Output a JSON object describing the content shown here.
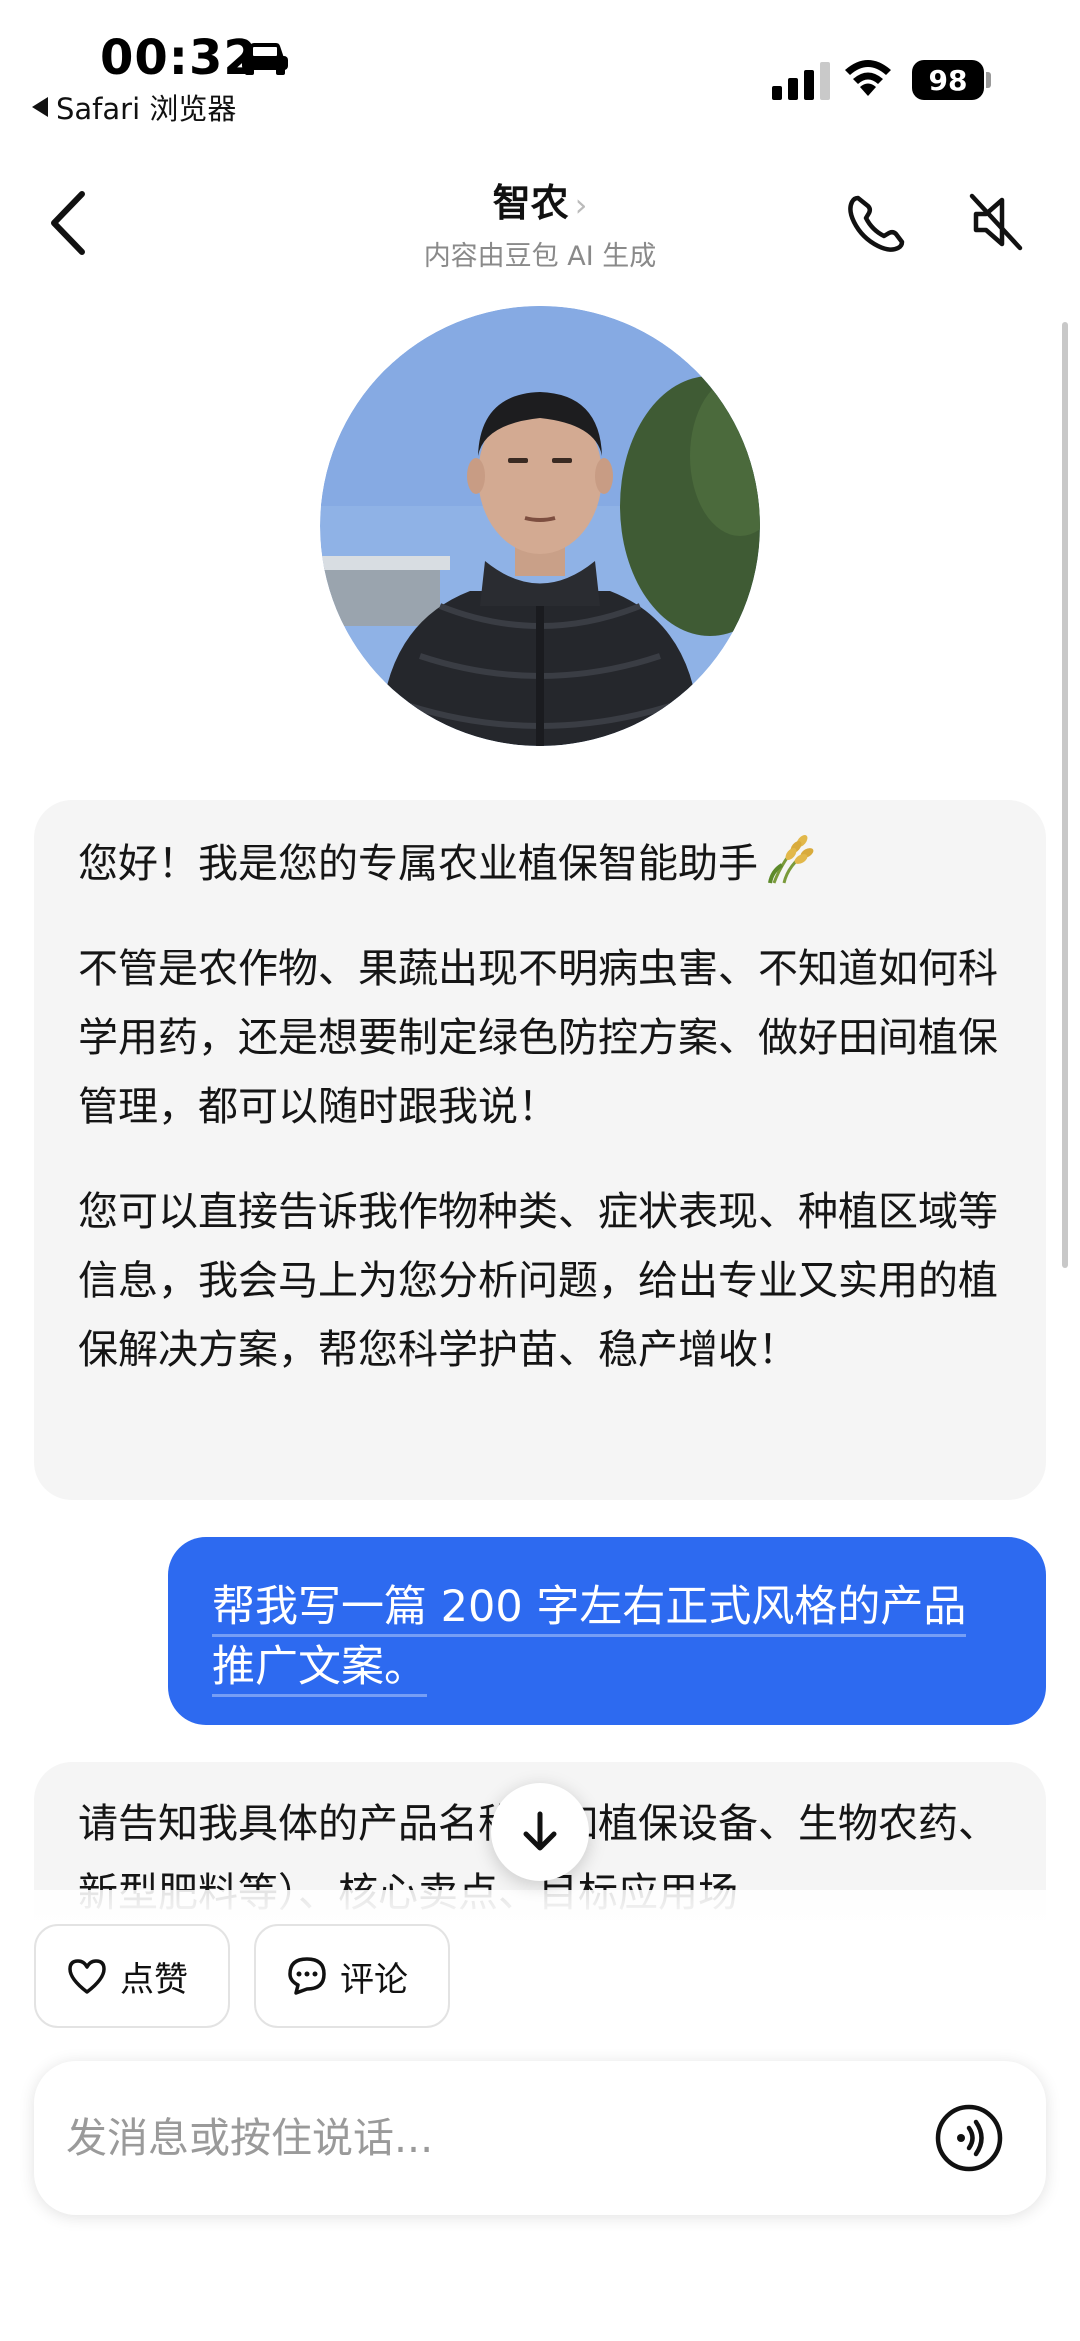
{
  "status_bar": {
    "time": "00:32",
    "back_app": "Safari 浏览器",
    "battery": "98"
  },
  "nav": {
    "title": "智农",
    "title_chevron": "›",
    "subtitle": "内容由豆包 AI 生成"
  },
  "messages": {
    "bot_1": {
      "p1": "您好！我是您的专属农业植保智能助手",
      "p2": "不管是农作物、果蔬出现不明病虫害、不知道如何科学用药，还是想要制定绿色防控方案、做好田间植保管理，都可以随时跟我说！",
      "p3": "您可以直接告诉我作物种类、症状表现、种植区域等信息，我会马上为您分析问题，给出专业又实用的植保解决方案，帮您科学护苗、稳产增收！"
    },
    "user_1": "帮我写一篇 200 字左右正式风格的产品推广文案。",
    "bot_2": "请告知我具体的产品名称（如植保设备、生物农药、新型肥料等）、核心卖点、目标应用场"
  },
  "actions": {
    "like": "点赞",
    "comment": "评论"
  },
  "input": {
    "placeholder": "发消息或按住说话..."
  },
  "colors": {
    "accent": "#2d6af0",
    "bot_bubble": "#f5f5f5"
  }
}
